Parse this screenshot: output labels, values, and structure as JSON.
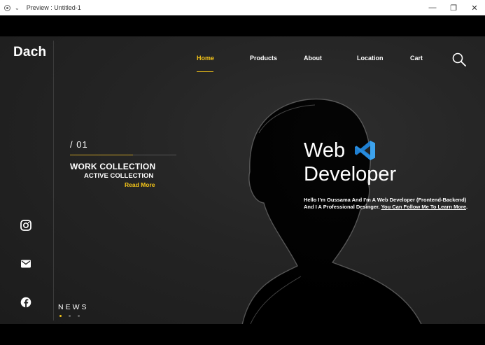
{
  "window": {
    "title": "Preview : Untitled-1",
    "controls": {
      "minimize": "—",
      "restore": "❐",
      "close": "✕"
    }
  },
  "site": {
    "logo": "Dach",
    "nav": [
      {
        "label": "Home",
        "active": true
      },
      {
        "label": "Products"
      },
      {
        "label": "About"
      },
      {
        "label": "Location"
      },
      {
        "label": "Cart"
      }
    ],
    "search_icon": "search-icon",
    "slide": {
      "counter": "/  01",
      "title": "WORK COLLECTION",
      "subtitle": "ACTIVE COLLECTION",
      "link": "Read More"
    },
    "hero": {
      "title_line1": "Web",
      "title_line2": "Developer",
      "logo_icon": "vscode-icon",
      "desc_line1": "Hello I'm Oussama And I'm A Web Developer (Frontend-Backend)",
      "desc_line2": "And I A Professional Desinger.",
      "desc_link": "You Can Follow Me To Learn More",
      "desc_end": "."
    },
    "social": [
      "instagram-icon",
      "mail-icon",
      "facebook-icon"
    ],
    "news_label": "NEWS",
    "colors": {
      "accent": "#f5c518",
      "background": "#242424",
      "vscode": "#2a8fe0"
    }
  }
}
